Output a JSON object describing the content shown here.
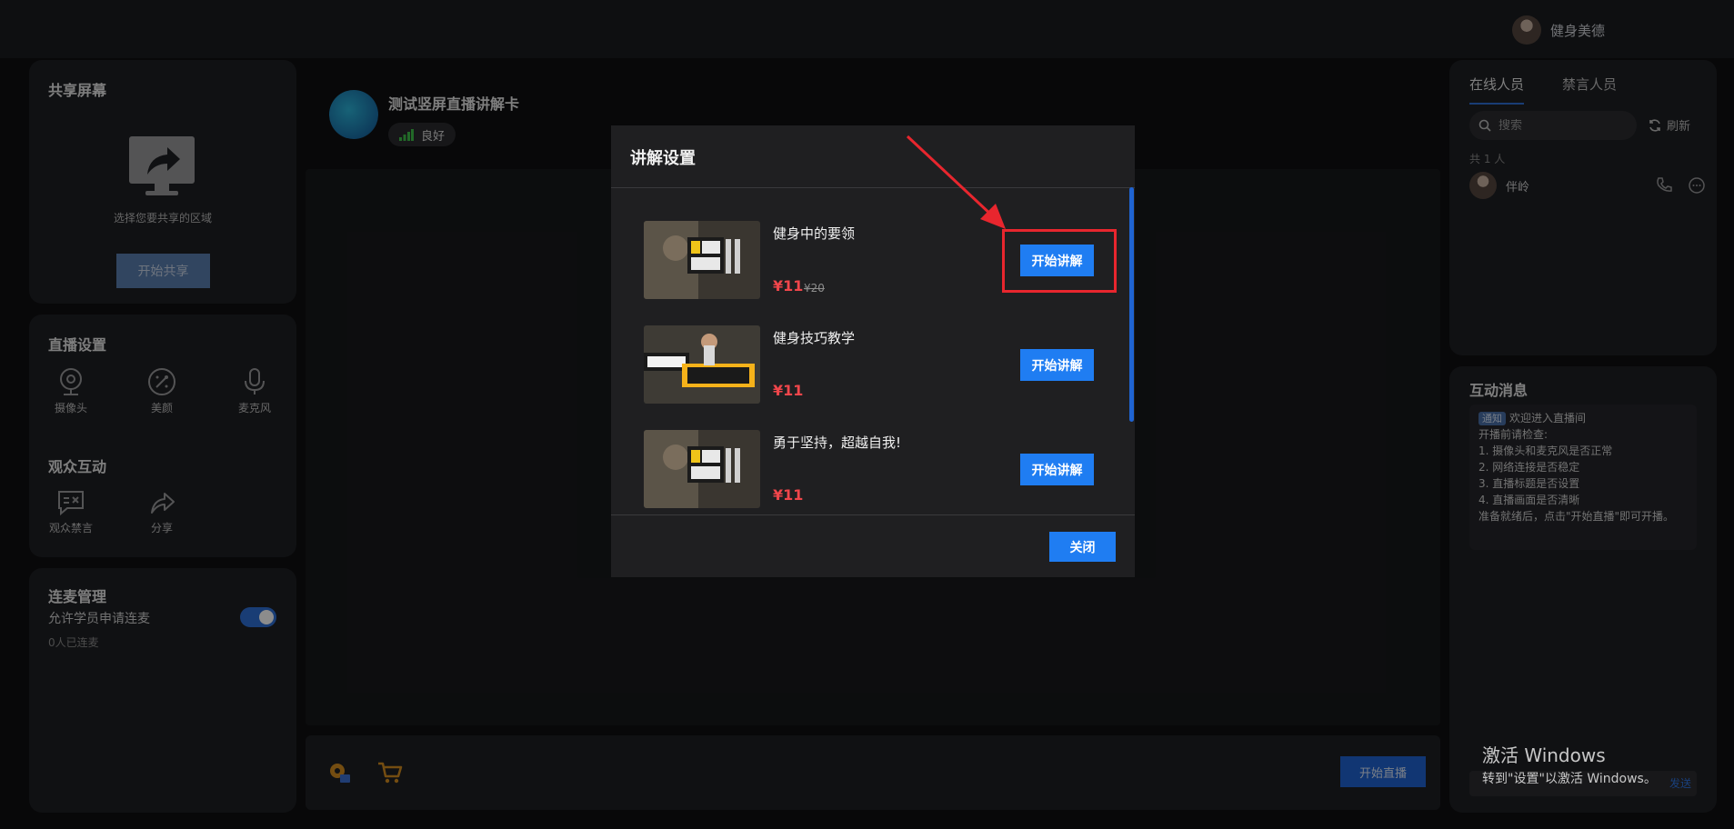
{
  "header": {
    "user_name": "健身美德"
  },
  "left": {
    "share": {
      "title": "共享屏幕",
      "hint": "选择您要共享的区域",
      "button": "开始共享"
    },
    "live_settings": {
      "title": "直播设置",
      "tools": [
        {
          "label": "摄像头",
          "icon": "camera-icon"
        },
        {
          "label": "美颜",
          "icon": "beauty-icon"
        },
        {
          "label": "麦克风",
          "icon": "microphone-icon"
        }
      ]
    },
    "audience": {
      "title": "观众互动",
      "tools": [
        {
          "label": "观众禁言",
          "icon": "mute-audience-icon"
        },
        {
          "label": "分享",
          "icon": "share-icon"
        }
      ]
    },
    "link_mic": {
      "title": "连麦管理",
      "allow_label": "允许学员申请连麦",
      "allow_enabled": true,
      "connected": "0人已连麦"
    }
  },
  "center": {
    "room_title": "测试竖屏直播讲解卡",
    "signal_label": "良好",
    "start_live_button": "开始直播"
  },
  "right": {
    "tabs": [
      {
        "label": "在线人员",
        "active": true
      },
      {
        "label": "禁言人员",
        "active": false
      }
    ],
    "search_placeholder": "搜索",
    "refresh_label": "刷新",
    "member_count": "共 1 人",
    "members": [
      {
        "name": "伴岭"
      }
    ],
    "messages_title": "互动消息",
    "notice_tag": "通知",
    "welcome": "欢迎进入直播间",
    "checklist": [
      "开播前请检查:",
      "1. 摄像头和麦克风是否正常",
      "2. 网络连接是否稳定",
      "3. 直播标题是否设置",
      "4. 直播画面是否清晰",
      "准备就绪后，点击\"开始直播\"即可开播。"
    ],
    "send_label": "发送"
  },
  "modal": {
    "title": "讲解设置",
    "products": [
      {
        "name": "健身中的要领",
        "price": "¥11",
        "original_price": "¥20",
        "button": "开始讲解"
      },
      {
        "name": "健身技巧教学",
        "price": "¥11",
        "original_price": "",
        "button": "开始讲解"
      },
      {
        "name": "勇于坚持，超越自我!",
        "price": "¥11",
        "original_price": "",
        "button": "开始讲解"
      }
    ],
    "close_button": "关闭"
  },
  "watermark": {
    "title": "激活 Windows",
    "subtitle": "转到\"设置\"以激活 Windows。"
  },
  "colors": {
    "accent": "#1f7df2",
    "price": "#f0464b",
    "annotation": "#e8262e"
  }
}
